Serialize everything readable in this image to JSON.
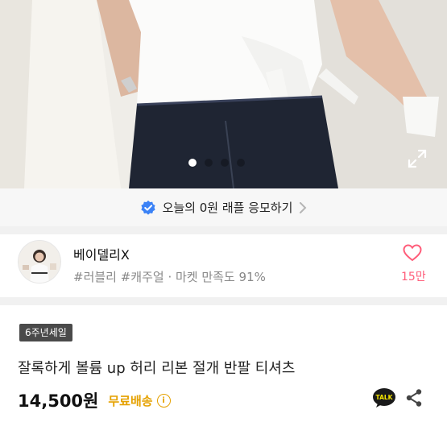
{
  "gallery": {
    "dot_count": 4,
    "active_index": 0,
    "expand_icon": "expand-icon"
  },
  "raffle": {
    "text": "오늘의 0원 래플 응모하기",
    "icon": "verified-check-icon",
    "chevron": "chevron-right-icon",
    "accent": "#3b82f6"
  },
  "seller": {
    "name": "베이델리X",
    "tags": "#러블리 #캐주얼 · 마켓 만족도 91%",
    "likes": "15만",
    "heart_color": "#ff5d7a"
  },
  "product": {
    "badge": "6주년세일",
    "title": "잘록하게 볼륨 up 허리 리본 절개 반팔 티셔츠",
    "price": "14,500원",
    "shipping": "무료배송",
    "shipping_color": "#e5a100",
    "info_icon": "info-icon"
  },
  "actions": {
    "talk_label": "TALK",
    "share_icon": "share-icon"
  }
}
